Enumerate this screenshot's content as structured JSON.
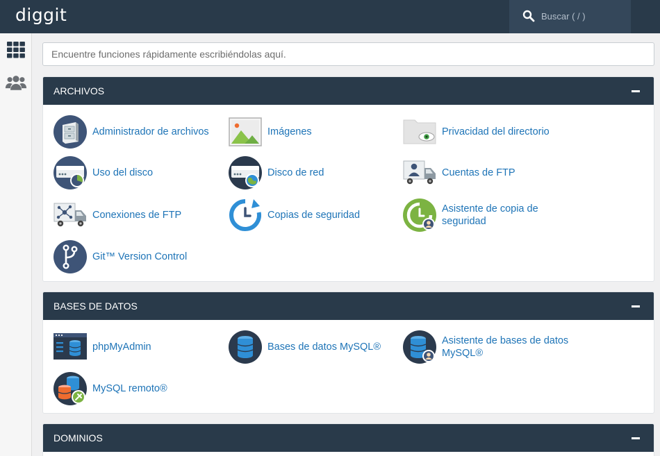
{
  "header": {
    "logo": "diggit",
    "search_label": "Buscar ( / )"
  },
  "sidebar": {
    "items": [
      {
        "name": "apps",
        "icon": "grid-icon"
      },
      {
        "name": "users",
        "icon": "users-icon"
      }
    ]
  },
  "quick_find": {
    "placeholder": "Encuentre funciones rápidamente escribiéndolas aquí."
  },
  "sections": {
    "archivos": {
      "title": "ARCHIVOS",
      "items": [
        "Administrador de archivos",
        "Imágenes",
        "Privacidad del directorio",
        "Uso del disco",
        "Disco de red",
        "Cuentas de FTP",
        "Conexiones de FTP",
        "Copias de seguridad",
        "Asistente de copia de seguridad",
        "Git™ Version Control"
      ]
    },
    "bases": {
      "title": "BASES DE DATOS",
      "items": [
        "phpMyAdmin",
        "Bases de datos MySQL®",
        "Asistente de bases de datos MySQL®",
        "MySQL remoto®"
      ]
    },
    "dominios": {
      "title": "DOMINIOS"
    }
  },
  "colors": {
    "header_bg": "#293a4a",
    "link": "#1e74b7",
    "icon_navy": "#3e5477",
    "icon_green": "#7cb342",
    "icon_blue": "#2f8fd6"
  }
}
